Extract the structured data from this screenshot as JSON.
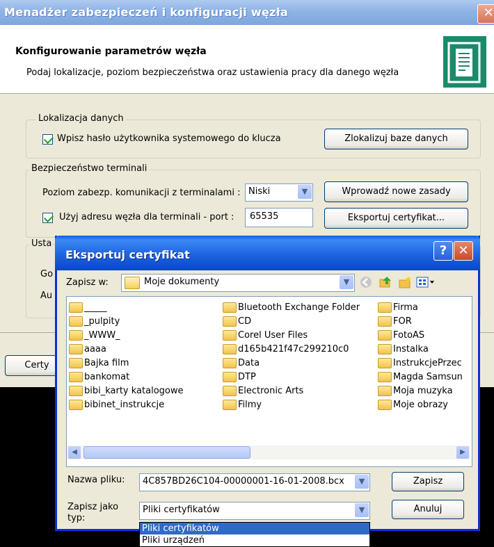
{
  "main": {
    "title": "Menadżer zabezpieczeń i konfiguracji węzła",
    "close_glyph": "✕",
    "header_title": "Konfigurowanie parametrów węzła",
    "header_subtitle": "Podaj lokalizacje, poziom bezpieczeństwa oraz ustawienia pracy dla danego węzła",
    "header_icon": "document-icon",
    "data_location": {
      "group_title": "Lokalizacja danych",
      "checkbox_label": "Wpisz hasło użytkownika systemowego do klucza",
      "checked": true,
      "locate_button": "Zlokalizuj baze danych"
    },
    "terminal_security": {
      "group_title": "Bezpieczeństwo terminali",
      "level_label": "Poziom zabezp. komunikacji z terminalami :",
      "level_value": "Niski",
      "new_rules_button": "Wprowadź nowe zasady",
      "use_address_label": "Użyj adresu węzła dla terminali - port :",
      "use_address_checked": true,
      "port_value": "65535",
      "export_button": "Eksportuj certyfikat..."
    },
    "partial_group_title": "Usta",
    "partial_row1": "Go",
    "partial_row2": "Au",
    "partial_button": "Certy"
  },
  "dialog": {
    "title": "Eksportuj certyfikat",
    "help_glyph": "?",
    "close_glyph": "✕",
    "save_in_label": "Zapisz w:",
    "save_in_value": "Moje dokumenty",
    "files_col1": [
      "_____",
      "_pulpity",
      "_WWW_",
      "aaaa",
      "Bajka film",
      "bankomat",
      "bibi_karty katalogowe",
      "bibinet_instrukcje"
    ],
    "files_col2": [
      "Bluetooth Exchange Folder",
      "CD",
      "Corel User Files",
      "d165b421f47c299210c0",
      "Data",
      "DTP",
      "Electronic Arts",
      "Filmy"
    ],
    "files_col3": [
      "Firma",
      "FOR",
      "FotoAS",
      "Instalka",
      "InstrukcjePrzec",
      "Magda Samsun",
      "Moja muzyka",
      "Moje obrazy"
    ],
    "filename_label": "Nazwa pliku:",
    "filename_value": "4C857BD26C104-00000001-16-01-2008.bcx",
    "save_button": "Zapisz",
    "type_label_line1": "Zapisz jako",
    "type_label_line2": "typ:",
    "type_value": "Pliki certyfikatów",
    "cancel_button": "Anuluj",
    "type_options": [
      "Pliki certyfikatów",
      "Pliki urządzeń"
    ]
  },
  "colors": {
    "accent": "#0831d9",
    "selection": "#316ac5",
    "window_bg": "#ece9d8"
  }
}
